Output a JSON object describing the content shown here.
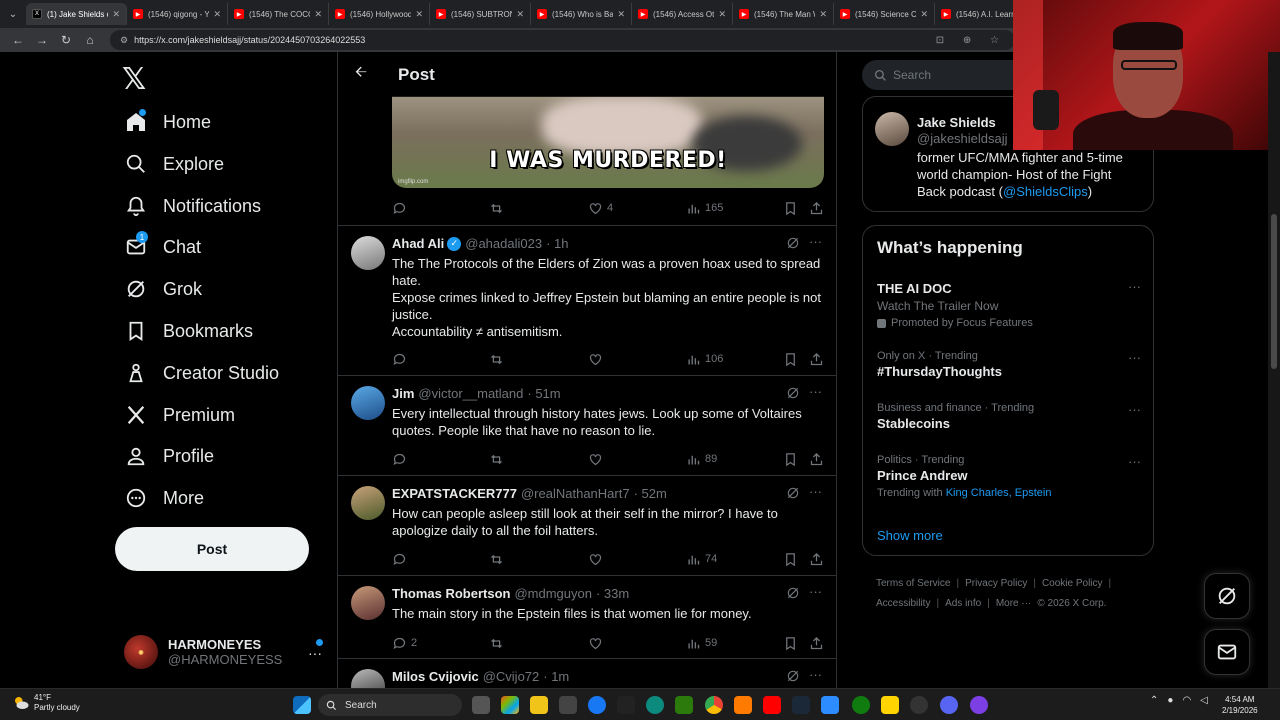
{
  "browser": {
    "tabs": [
      {
        "label": "(1) Jake Shields on",
        "active": true,
        "favicon": "x-icon"
      },
      {
        "label": "(1546) qigong - Yo",
        "active": false,
        "favicon": "youtube-icon"
      },
      {
        "label": "(1546) The COCO",
        "active": false,
        "favicon": "youtube-icon"
      },
      {
        "label": "(1546) Hollywood",
        "active": false,
        "favicon": "youtube-icon"
      },
      {
        "label": "(1546) SUBTRONIC",
        "active": false,
        "favicon": "youtube-icon"
      },
      {
        "label": "(1546) Who is Ba",
        "active": false,
        "favicon": "youtube-icon"
      },
      {
        "label": "(1546) Access Ot",
        "active": false,
        "favicon": "youtube-icon"
      },
      {
        "label": "(1546) The Man W",
        "active": false,
        "favicon": "youtube-icon"
      },
      {
        "label": "(1546) Science Co",
        "active": false,
        "favicon": "youtube-icon"
      },
      {
        "label": "(1546) A.I. Learn",
        "active": false,
        "favicon": "youtube-icon"
      }
    ],
    "url": "https://x.com/jakeshieldsajj/status/2024450703264022553"
  },
  "nav": {
    "items": [
      {
        "label": "Home",
        "icon": "home-icon"
      },
      {
        "label": "Explore",
        "icon": "search-icon"
      },
      {
        "label": "Notifications",
        "icon": "bell-icon"
      },
      {
        "label": "Chat",
        "icon": "mail-icon",
        "badge": "1"
      },
      {
        "label": "Grok",
        "icon": "grok-icon"
      },
      {
        "label": "Bookmarks",
        "icon": "bookmark-icon"
      },
      {
        "label": "Creator Studio",
        "icon": "creator-icon"
      },
      {
        "label": "Premium",
        "icon": "x-icon"
      },
      {
        "label": "Profile",
        "icon": "person-icon"
      },
      {
        "label": "More",
        "icon": "more-circle-icon"
      }
    ],
    "post_label": "Post",
    "account": {
      "display_name": "HARMONEYES",
      "handle": "@HARMONEYESS"
    }
  },
  "header": {
    "title": "Post"
  },
  "media": {
    "caption": "I WAS MURDERED!",
    "watermark": "imgflip.com"
  },
  "main_post_stats": {
    "likes": "4",
    "views": "165"
  },
  "replies": [
    {
      "name": "Ahad Ali",
      "verified": true,
      "handle": "@ahadali023",
      "time": "· 1h",
      "lines": [
        "The The Protocols of the Elders of Zion was a proven hoax used to spread hate.",
        "Expose crimes linked to Jeffrey Epstein but blaming an entire people is not justice.",
        "Accountability ≠ antisemitism."
      ],
      "replies": "",
      "likes": "",
      "views": "106"
    },
    {
      "name": "Jim",
      "verified": false,
      "handle": "@victor__matland",
      "time": "· 51m",
      "lines": [
        "Every intellectual through history hates jews. Look up some of Voltaires quotes. People like that have no reason to lie."
      ],
      "replies": "",
      "likes": "",
      "views": "89"
    },
    {
      "name": "EXPATSTACKER777",
      "verified": false,
      "handle": "@realNathanHart7",
      "time": "· 52m",
      "lines": [
        "How can people asleep still look at their self in the mirror? I have to apologize daily to all the foil hatters."
      ],
      "replies": "",
      "likes": "",
      "views": "74"
    },
    {
      "name": "Thomas Robertson",
      "verified": false,
      "handle": "@mdmguyon",
      "time": "· 33m",
      "lines": [
        "The main story in the Epstein files is that women lie for money."
      ],
      "replies": "2",
      "likes": "",
      "views": "59"
    },
    {
      "name": "Milos Cvijovic",
      "verified": false,
      "handle": "@Cvijo72",
      "time": "· 1m",
      "lines": [],
      "replies": "",
      "likes": "",
      "views": ""
    }
  ],
  "right": {
    "search_placeholder": "Search",
    "profile": {
      "name": "Jake Shields",
      "handle": "@jakeshieldsajj",
      "bio": "former UFC/MMA fighter and 5-time world champion- Host of the Fight Back podcast (",
      "bio_link": "@ShieldsClips",
      "bio_end": ")"
    },
    "trending_title": "What’s happening",
    "trends": [
      {
        "meta": "",
        "title": "THE AI DOC",
        "sub": "Watch The Trailer Now",
        "promo": "Promoted by Focus Features"
      },
      {
        "meta": "Only on X · Trending",
        "title": "#ThursdayThoughts"
      },
      {
        "meta": "Business and finance · Trending",
        "title": "Stablecoins"
      },
      {
        "meta": "Politics · Trending",
        "title": "Prince Andrew",
        "with_label": "Trending with",
        "with_links": "King Charles, Epstein"
      }
    ],
    "show_more": "Show more",
    "footer": [
      "Terms of Service",
      "Privacy Policy",
      "Cookie Policy",
      "Accessibility",
      "Ads info",
      "More ···",
      "© 2026 X Corp."
    ]
  },
  "taskbar": {
    "temp": "41°F",
    "weather": "Partly cloudy",
    "search": "Search",
    "time": "4:54 AM",
    "date": "2/19/2026"
  }
}
